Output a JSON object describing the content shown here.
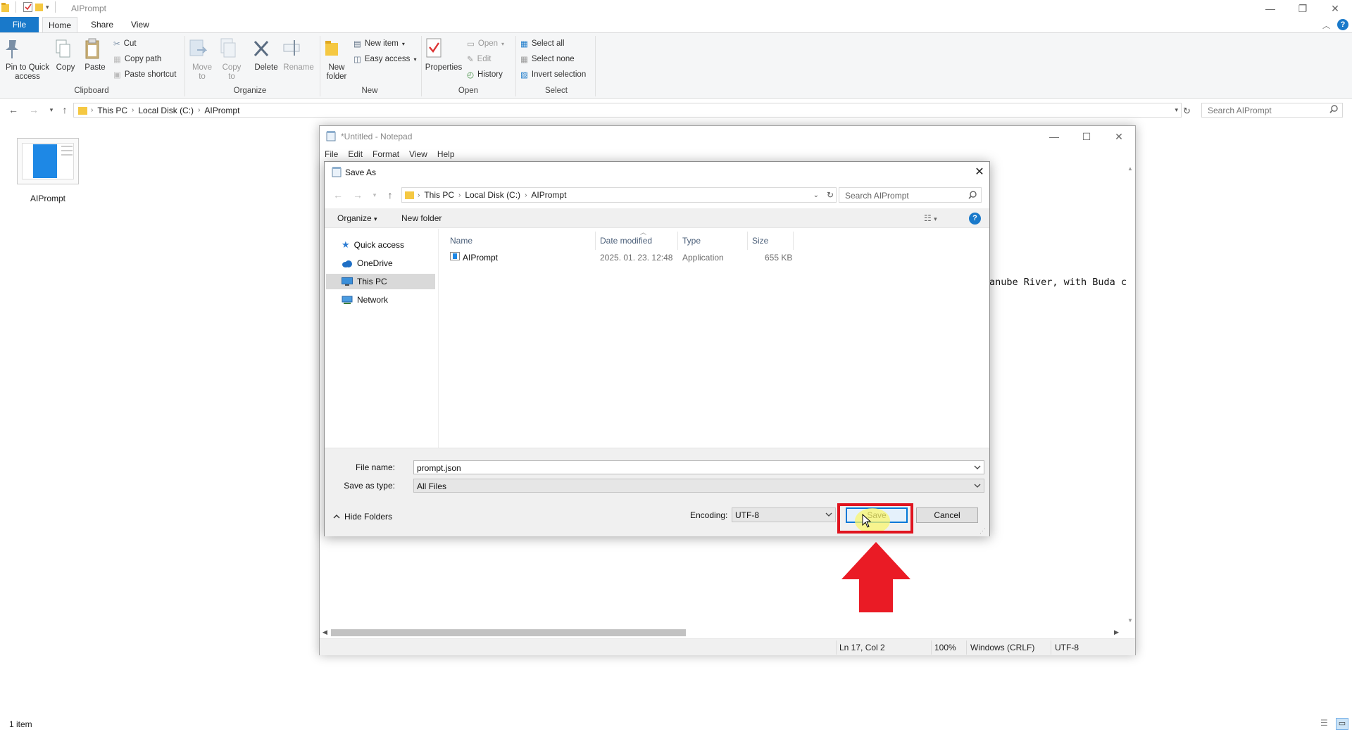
{
  "explorer": {
    "title": "AIPrompt",
    "tabs": [
      {
        "label": "File"
      },
      {
        "label": "Home"
      },
      {
        "label": "Share"
      },
      {
        "label": "View"
      }
    ],
    "ribbon": {
      "pin_to_quick_access": "Pin to Quick access",
      "copy": "Copy",
      "paste": "Paste",
      "cut": "Cut",
      "copy_path": "Copy path",
      "paste_shortcut": "Paste shortcut",
      "move_to": "Move to",
      "copy_to": "Copy to",
      "delete": "Delete",
      "rename": "Rename",
      "new_folder": "New folder",
      "new_item": "New item",
      "easy_access": "Easy access",
      "properties": "Properties",
      "open": "Open",
      "edit": "Edit",
      "history": "History",
      "select_all": "Select all",
      "select_none": "Select none",
      "invert_selection": "Invert selection",
      "groups": {
        "clipboard": "Clipboard",
        "organize": "Organize",
        "new": "New",
        "open": "Open",
        "select": "Select"
      }
    },
    "breadcrumb": [
      "This PC",
      "Local Disk (C:)",
      "AIPrompt"
    ],
    "search_placeholder": "Search AIPrompt",
    "items": [
      {
        "name": "AIPrompt"
      }
    ],
    "status": "1 item"
  },
  "notepad": {
    "title": "*Untitled - Notepad",
    "menu": [
      "File",
      "Edit",
      "Format",
      "View",
      "Help"
    ],
    "visible_text": "anube River, with Buda c",
    "status": {
      "position": "Ln 17, Col 2",
      "zoom": "100%",
      "line_ending": "Windows (CRLF)",
      "encoding": "UTF-8"
    }
  },
  "save_dialog": {
    "title": "Save As",
    "breadcrumb": [
      "This PC",
      "Local Disk (C:)",
      "AIPrompt"
    ],
    "search_placeholder": "Search AIPrompt",
    "toolbar": {
      "organize": "Organize",
      "new_folder": "New folder"
    },
    "nav": [
      {
        "label": "Quick access",
        "icon": "star-icon"
      },
      {
        "label": "OneDrive",
        "icon": "cloud-icon"
      },
      {
        "label": "This PC",
        "icon": "computer-icon"
      },
      {
        "label": "Network",
        "icon": "network-icon"
      }
    ],
    "columns": {
      "name": "Name",
      "date_modified": "Date modified",
      "type": "Type",
      "size": "Size"
    },
    "files": [
      {
        "name": "AIPrompt",
        "date_modified": "2025. 01. 23. 12:48",
        "type": "Application",
        "size": "655 KB"
      }
    ],
    "file_name_label": "File name:",
    "file_name_value": "prompt.json",
    "save_as_type_label": "Save as type:",
    "save_as_type_value": "All Files",
    "hide_folders": "Hide Folders",
    "encoding_label": "Encoding:",
    "encoding_value": "UTF-8",
    "save_button": "Save",
    "cancel_button": "Cancel"
  },
  "colors": {
    "accent": "#0078d7",
    "file_tab": "#1979ca",
    "highlight": "#e0141f"
  }
}
